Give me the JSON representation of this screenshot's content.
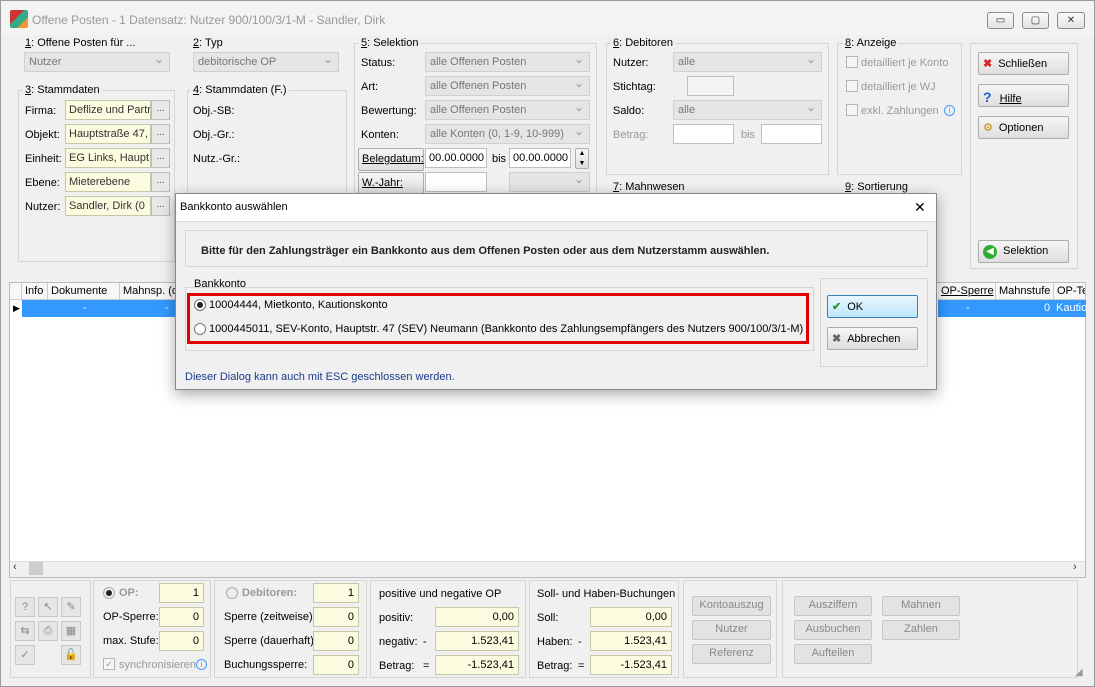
{
  "window": {
    "title": "Offene Posten - 1 Datensatz:  Nutzer 900/100/3/1-M - Sandler, Dirk",
    "minimize": "▭",
    "restore": "▢",
    "close": "✕"
  },
  "g1": {
    "title_key": "1",
    "title": ": Offene Posten für ...",
    "value": "Nutzer"
  },
  "g2": {
    "title_key": "2",
    "title": ": Typ",
    "value": "debitorische OP"
  },
  "g3": {
    "title_key": "3",
    "title": ": Stammdaten",
    "firma_label": "Firma:",
    "firma": "Deflize und Partr",
    "objekt_label": "Objekt:",
    "objekt": "Hauptstraße 47,",
    "einheit_label": "Einheit:",
    "einheit": "EG Links, Haupt",
    "ebene_label": "Ebene:",
    "ebene": "Mieterebene",
    "nutzer_label": "Nutzer:",
    "nutzer": "Sandler, Dirk  (0",
    "dots": "..."
  },
  "g4": {
    "title_key": "4",
    "title": ": Stammdaten (F.)",
    "objsb": "Obj.-SB:",
    "objgr": "Obj.-Gr.:",
    "nutzgr": "Nutz.-Gr.:"
  },
  "g5": {
    "title_key": "5",
    "title": ": Selektion",
    "status_label": "Status:",
    "status": "alle Offenen Posten",
    "art_label": "Art:",
    "art": "alle Offenen Posten",
    "bew_label": "Bewertung:",
    "bew": "alle Offenen Posten",
    "konten_label": "Konten:",
    "konten": "alle Konten (0, 1-9, 10-999)",
    "beleg_label": "Belegdatum:",
    "date_from": "00.00.0000",
    "bis": "bis",
    "date_to": "00.00.0000",
    "wjahr_label": "W.-Jahr:"
  },
  "g6": {
    "title_key": "6",
    "title": ": Debitoren",
    "nutzer_label": "Nutzer:",
    "nutzer": "alle",
    "stichtag_label": "Stichtag:",
    "saldo_label": "Saldo:",
    "saldo": "alle",
    "betrag_label": "Betrag:",
    "bis": "bis"
  },
  "g7": {
    "title_key": "7",
    "title": ": Mahnwesen"
  },
  "g8": {
    "title_key": "8",
    "title": ": Anzeige",
    "c1": "detailliert je Konto",
    "c2": "detailliert je WJ",
    "c3": "exkl. Zahlungen"
  },
  "g9": {
    "title_key": "9",
    "title": ": Sortierung"
  },
  "side": {
    "schliessen": "Schließen",
    "hilfe": "Hilfe",
    "optionen": "Optionen",
    "selektion": "Selektion"
  },
  "grid": {
    "headers_left": [
      "Info",
      "Dokumente",
      "Mahnsp. (c"
    ],
    "headers_right": [
      "OP-Sperre",
      "Mahnstufe",
      "OP-Te"
    ],
    "row": {
      "c1": "-",
      "c2": "-",
      "opsperre": "-",
      "mahnstufe": "0",
      "opte": "Kautio"
    }
  },
  "bottom": {
    "op_label": "OP:",
    "op_val": "1",
    "opsperre_label": "OP-Sperre:",
    "opsperre_val": "0",
    "maxstufe_label": "max. Stufe:",
    "maxstufe_val": "0",
    "sync": "synchronisieren",
    "deb_label": "Debitoren:",
    "deb_val": "1",
    "sperre_zeit": "Sperre (zeitweise):",
    "sperre_zeit_val": "0",
    "sperre_dauer": "Sperre (dauerhaft):",
    "sperre_dauer_val": "0",
    "buchungssperre": "Buchungssperre:",
    "buchungssperre_val": "0",
    "posneg_title": "positive und negative OP",
    "positiv": "positiv:",
    "positiv_val": "0,00",
    "negativ": "negativ:",
    "negativ_sign": "-",
    "negativ_val": "1.523,41",
    "betrag": "Betrag:",
    "betrag_sign": "=",
    "betrag_val": "-1.523,41",
    "sh_title": "Soll- und Haben-Buchungen",
    "soll": "Soll:",
    "soll_val": "0,00",
    "haben": "Haben:",
    "haben_sign": "-",
    "haben_val": "1.523,41",
    "sbetrag": "Betrag:",
    "sbetrag_sign": "=",
    "sbetrag_val": "-1.523,41",
    "kontoauszug": "Kontoauszug",
    "nutzer": "Nutzer",
    "referenz": "Referenz",
    "ausziffern": "Ausziffern",
    "ausbuchen": "Ausbuchen",
    "aufteilen": "Aufteilen",
    "mahnen": "Mahnen",
    "zahlen": "Zahlen"
  },
  "dialog": {
    "title": "Bankkonto auswählen",
    "message": "Bitte für den Zahlungsträger ein Bankkonto aus dem Offenen Posten oder aus dem Nutzerstamm auswählen.",
    "group": "Bankkonto",
    "option1": "10004444,  Mietkonto,  Kautionskonto",
    "option2": "1000445011,  SEV-Konto,  Hauptstr. 47 (SEV) Neumann  (Bankkonto des Zahlungsempfängers des Nutzers 900/100/3/1-M)",
    "ok": "OK",
    "cancel": "Abbrechen",
    "footer": "Dieser Dialog kann auch mit ESC geschlossen werden.",
    "close": "✕"
  },
  "colors": {
    "highlight": "#e00000",
    "selection": "#3399ff",
    "field_yellow": "#fbfbe0"
  }
}
